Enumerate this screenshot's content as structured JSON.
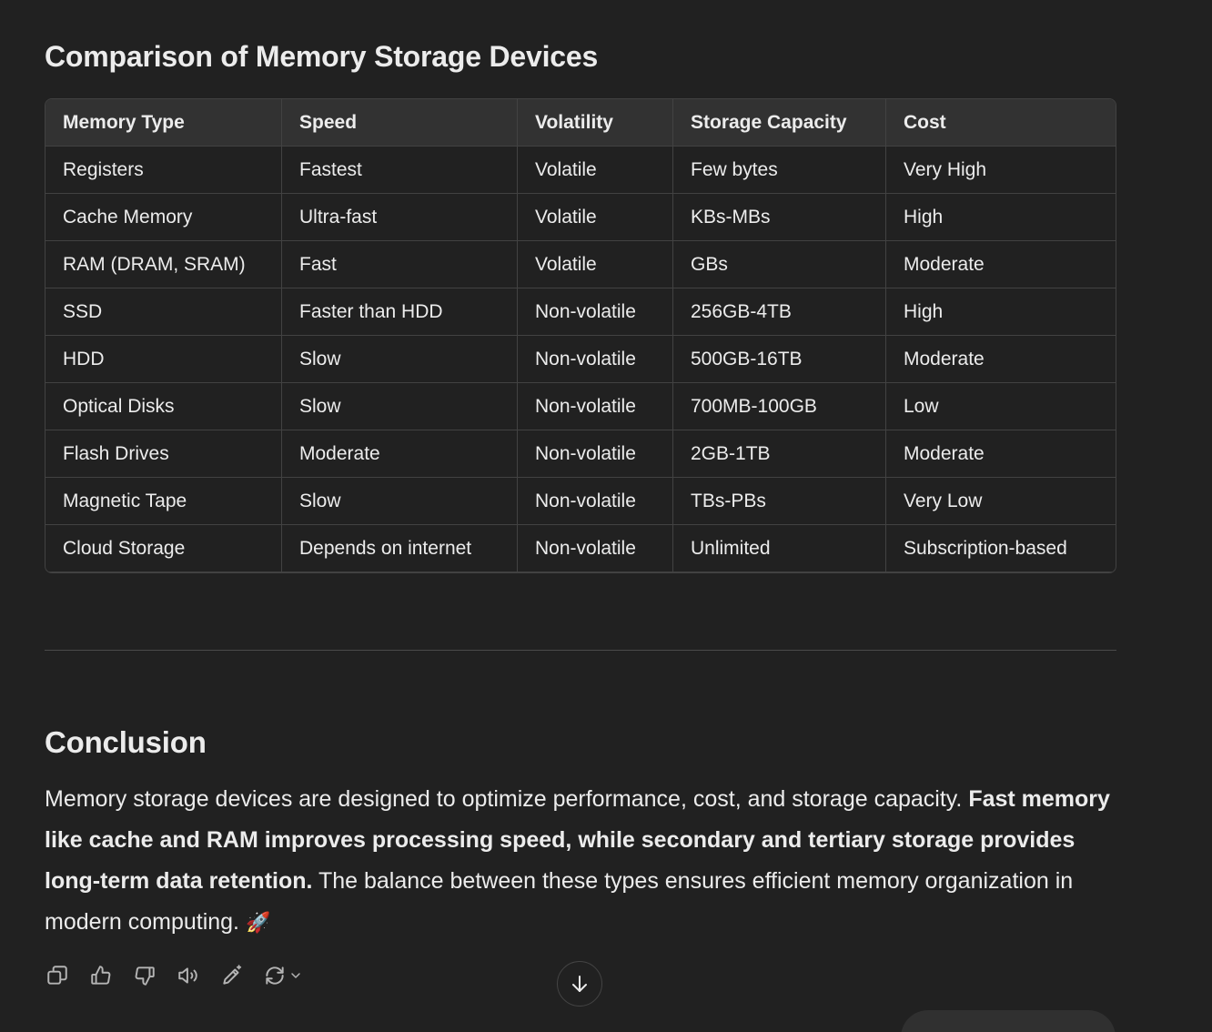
{
  "section": {
    "title": "Comparison of Memory Storage Devices"
  },
  "table": {
    "headers": [
      "Memory Type",
      "Speed",
      "Volatility",
      "Storage Capacity",
      "Cost"
    ],
    "rows": [
      [
        "Registers",
        "Fastest",
        "Volatile",
        "Few bytes",
        "Very High"
      ],
      [
        "Cache Memory",
        "Ultra-fast",
        "Volatile",
        "KBs-MBs",
        "High"
      ],
      [
        "RAM (DRAM, SRAM)",
        "Fast",
        "Volatile",
        "GBs",
        "Moderate"
      ],
      [
        "SSD",
        "Faster than HDD",
        "Non-volatile",
        "256GB-4TB",
        "High"
      ],
      [
        "HDD",
        "Slow",
        "Non-volatile",
        "500GB-16TB",
        "Moderate"
      ],
      [
        "Optical Disks",
        "Slow",
        "Non-volatile",
        "700MB-100GB",
        "Low"
      ],
      [
        "Flash Drives",
        "Moderate",
        "Non-volatile",
        "2GB-1TB",
        "Moderate"
      ],
      [
        "Magnetic Tape",
        "Slow",
        "Non-volatile",
        "TBs-PBs",
        "Very Low"
      ],
      [
        "Cloud Storage",
        "Depends on internet",
        "Non-volatile",
        "Unlimited",
        "Subscription-based"
      ]
    ]
  },
  "conclusion": {
    "title": "Conclusion",
    "text_1": "Memory storage devices are designed to optimize performance, cost, and storage capacity. ",
    "text_bold": "Fast memory like cache and RAM improves processing speed, while secondary and tertiary storage provides long-term data retention.",
    "text_2": " The balance between these types ensures efficient memory organization in modern computing. ",
    "emoji": "🚀"
  },
  "actions": {
    "icons": [
      "copy-icon",
      "thumbs-up-icon",
      "thumbs-down-icon",
      "read-aloud-icon",
      "edit-icon",
      "regenerate-icon",
      "chevron-down-icon"
    ]
  },
  "scroll": {
    "icon": "arrow-down-icon"
  },
  "colors": {
    "background": "#212121",
    "text": "#ececec",
    "header_bg": "#323232",
    "border": "#424242",
    "icon": "#b4b4b4"
  }
}
